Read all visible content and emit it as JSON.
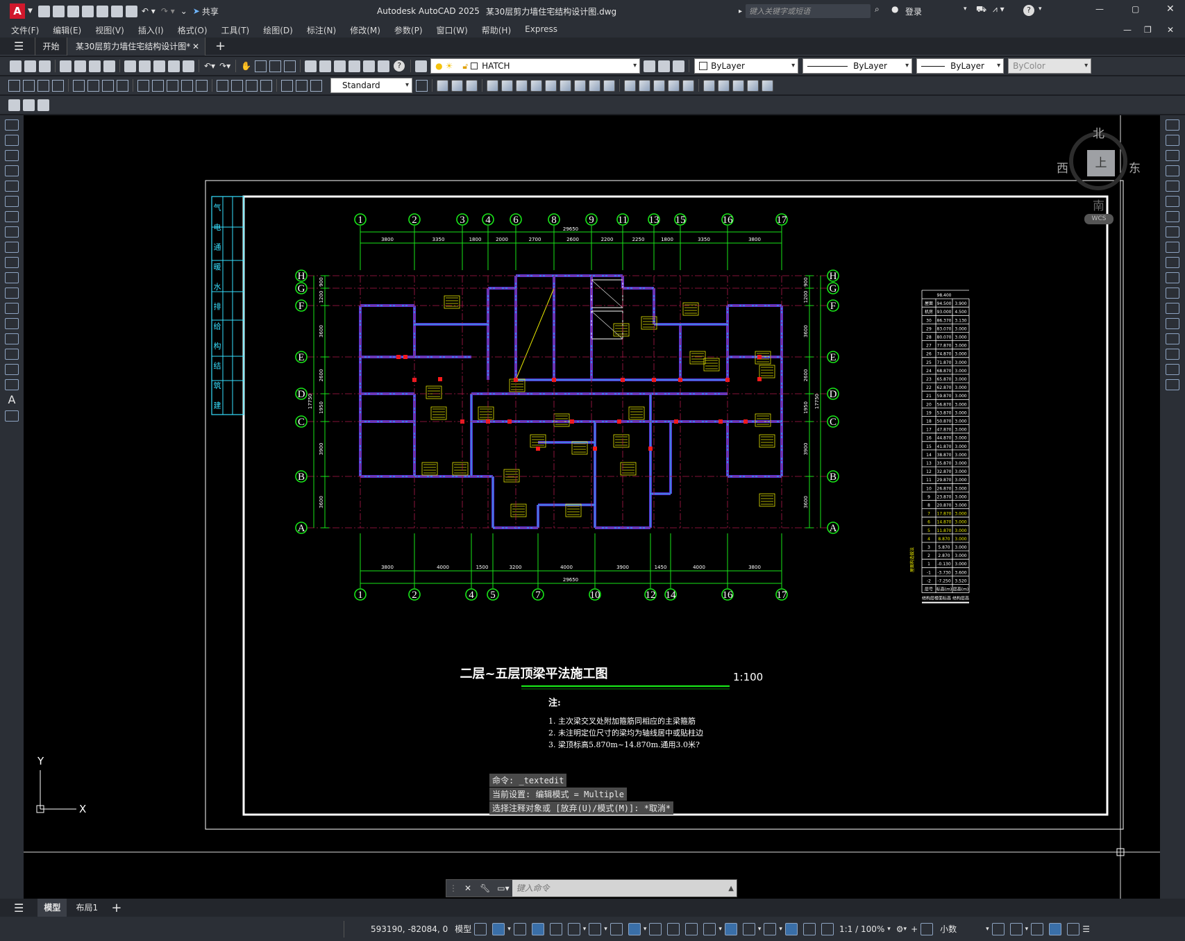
{
  "app": {
    "title": "Autodesk AutoCAD 2025",
    "doc": "某30层剪力墙住宅结构设计图.dwg",
    "search_placeholder": "键入关键字或短语",
    "share": "共享",
    "login": "登录"
  },
  "menus": [
    "文件(F)",
    "编辑(E)",
    "视图(V)",
    "插入(I)",
    "格式(O)",
    "工具(T)",
    "绘图(D)",
    "标注(N)",
    "修改(M)",
    "参数(P)",
    "窗口(W)",
    "帮助(H)",
    "Express"
  ],
  "tabs": {
    "start": "开始",
    "doc": "某30层剪力墙住宅结构设计图*"
  },
  "toolbar": {
    "hatch": "HATCH",
    "layer_color": "ByLayer",
    "linetype": "ByLayer",
    "lineweight": "ByLayer",
    "plotstyle": "ByColor",
    "textstyle": "Standard"
  },
  "viewcube": {
    "n": "北",
    "s": "南",
    "e": "东",
    "w": "西",
    "top": "上",
    "wcs": "WCS"
  },
  "drawing": {
    "title": "二层~五层顶梁平法施工图",
    "scale": "1:100",
    "notes_title": "注:",
    "notes": [
      "1.  主次梁交叉处附加箍筋同相应的主梁箍筋",
      "2.  未注明定位尺寸的梁均为轴线居中或贴柱边",
      "3.  梁顶标高5.870m~14.870m.通用3.0米?"
    ],
    "top_axes": [
      "1",
      "2",
      "3",
      "4",
      "6",
      "8",
      "9",
      "11",
      "13",
      "15",
      "16",
      "17"
    ],
    "bottom_axes": [
      "1",
      "2",
      "4",
      "5",
      "7",
      "10",
      "12",
      "14",
      "16",
      "17"
    ],
    "row_axes": [
      "H",
      "G",
      "F",
      "E",
      "D",
      "C",
      "B",
      "A"
    ],
    "top_dims": [
      "3800",
      "3350",
      "1800",
      "2000",
      "2700",
      "2600",
      "2200",
      "2250",
      "1800",
      "3350",
      "3800"
    ],
    "top_total": "29650",
    "bottom_dims": [
      "3800",
      "4000",
      "1500",
      "3200",
      "4000",
      "3900",
      "1450",
      "4000",
      "3800"
    ],
    "bottom_total": "29650",
    "left_dims": [
      "900",
      "1200",
      "3600",
      "2600",
      "1950",
      "3900",
      "3600"
    ],
    "left_total": "17750",
    "title_block": [
      "建",
      "筑",
      "结",
      "构",
      "给",
      "排",
      "水",
      "暖",
      "通",
      "电",
      "气"
    ],
    "level_table": {
      "rows": [
        [
          "",
          "98.400",
          ""
        ],
        [
          "屋面",
          "94.500",
          "3.900"
        ],
        [
          "机房",
          "93.000",
          "4.500"
        ],
        [
          "30",
          "86.370",
          "3.130"
        ],
        [
          "29",
          "83.070",
          "3.000"
        ],
        [
          "28",
          "80.070",
          "3.000"
        ],
        [
          "27",
          "77.870",
          "3.000"
        ],
        [
          "26",
          "74.870",
          "3.000"
        ],
        [
          "25",
          "71.870",
          "3.000"
        ],
        [
          "24",
          "68.870",
          "3.000"
        ],
        [
          "23",
          "65.870",
          "3.000"
        ],
        [
          "22",
          "62.870",
          "3.000"
        ],
        [
          "21",
          "59.870",
          "3.000"
        ],
        [
          "20",
          "56.870",
          "3.000"
        ],
        [
          "19",
          "53.870",
          "3.000"
        ],
        [
          "18",
          "50.870",
          "3.000"
        ],
        [
          "17",
          "47.870",
          "3.000"
        ],
        [
          "16",
          "44.870",
          "3.000"
        ],
        [
          "15",
          "41.870",
          "3.000"
        ],
        [
          "14",
          "38.870",
          "3.000"
        ],
        [
          "13",
          "35.870",
          "3.000"
        ],
        [
          "12",
          "32.870",
          "3.000"
        ],
        [
          "11",
          "29.870",
          "3.000"
        ],
        [
          "10",
          "26.870",
          "3.000"
        ],
        [
          "9",
          "23.870",
          "3.000"
        ],
        [
          "8",
          "20.870",
          "3.000"
        ],
        [
          "7",
          "17.870",
          "3.000"
        ],
        [
          "6",
          "14.870",
          "3.000"
        ],
        [
          "5",
          "11.870",
          "3.000"
        ],
        [
          "4",
          "8.870",
          "3.000"
        ],
        [
          "3",
          "5.870",
          "3.000"
        ],
        [
          "2",
          "2.870",
          "3.000"
        ],
        [
          "1",
          "-0.130",
          "3.000"
        ],
        [
          "-1",
          "-3.730",
          "3.600"
        ],
        [
          "-2",
          "-7.250",
          "3.520"
        ],
        [
          "层号",
          "标高(m)",
          "层高(m)"
        ]
      ],
      "caption": "结构层楼面标高 结构层高",
      "side": "屋面构造做法"
    }
  },
  "command": {
    "lines": [
      "命令: _textedit",
      "当前设置: 编辑模式 = Multiple",
      "选择注释对象或 [放弃(U)/模式(M)]: *取消*"
    ],
    "placeholder": "键入命令"
  },
  "ucs": {
    "x": "X",
    "y": "Y"
  },
  "layout_tabs": [
    "模型",
    "布局1"
  ],
  "status": {
    "coords": "593190, -82084, 0",
    "model": "模型",
    "scale": "1:1 / 100%",
    "units": "小数"
  }
}
